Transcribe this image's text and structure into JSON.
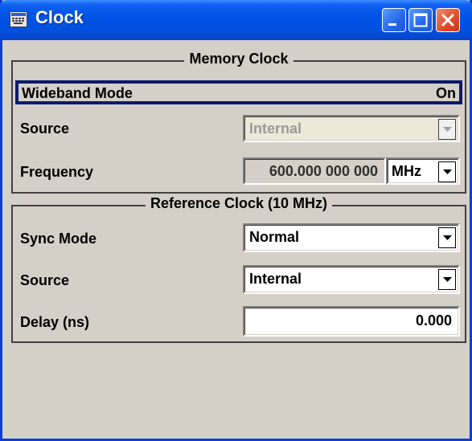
{
  "window": {
    "title": "Clock",
    "icon": "keyboard-icon",
    "controls": [
      "minimize-icon",
      "maximize-icon",
      "close-icon"
    ]
  },
  "memory_clock": {
    "title": "Memory Clock",
    "wideband_mode": {
      "label": "Wideband Mode",
      "value": "On"
    },
    "source": {
      "label": "Source",
      "value": "Internal"
    },
    "frequency": {
      "label": "Frequency",
      "value": "600.000 000 000",
      "unit": "MHz"
    }
  },
  "reference_clock": {
    "title": "Reference Clock (10 MHz)",
    "sync_mode": {
      "label": "Sync Mode",
      "value": "Normal"
    },
    "source": {
      "label": "Source",
      "value": "Internal"
    },
    "delay": {
      "label": "Delay (ns)",
      "value": "0.000"
    }
  },
  "colors": {
    "titlebar": "#0054e3",
    "panel": "#d4d0c8",
    "close_button": "#e0502c",
    "selection_border": "#0a1a6e"
  }
}
